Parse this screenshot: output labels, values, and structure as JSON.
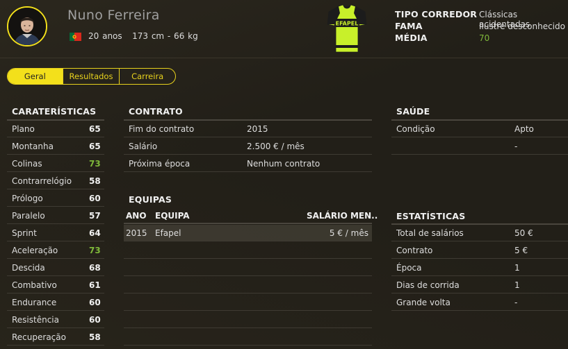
{
  "rider": {
    "name": "Nuno Ferreira",
    "age": "20 anos",
    "height_weight": "173 cm - 66 kg",
    "flag_colors": {
      "green": "#046a38",
      "red": "#da291c"
    }
  },
  "summary": [
    {
      "label": "TIPO CORREDOR",
      "value": "Clássicas acidentadas"
    },
    {
      "label": "FAMA",
      "value": "Ilustre desconhecido"
    },
    {
      "label": "MÉDIA",
      "value": "70"
    }
  ],
  "tabs": [
    "Geral",
    "Resultados",
    "Carreira"
  ],
  "characteristics": {
    "title": "CARATERÍSTICAS",
    "items": [
      {
        "label": "Plano",
        "value": "65"
      },
      {
        "label": "Montanha",
        "value": "65"
      },
      {
        "label": "Colinas",
        "value": "73"
      },
      {
        "label": "Contrarrelógio",
        "value": "58"
      },
      {
        "label": "Prólogo",
        "value": "60"
      },
      {
        "label": "Paralelo",
        "value": "57"
      },
      {
        "label": "Sprint",
        "value": "64"
      },
      {
        "label": "Aceleração",
        "value": "73"
      },
      {
        "label": "Descida",
        "value": "68"
      },
      {
        "label": "Combativo",
        "value": "61"
      },
      {
        "label": "Endurance",
        "value": "60"
      },
      {
        "label": "Resistência",
        "value": "60"
      },
      {
        "label": "Recuperação",
        "value": "58"
      }
    ]
  },
  "contract": {
    "title": "CONTRATO",
    "rows": [
      {
        "label": "Fim do contrato",
        "value": "2015"
      },
      {
        "label": "Salário",
        "value": "2.500 € / mês"
      },
      {
        "label": "Próxima época",
        "value": "Nenhum contrato"
      }
    ]
  },
  "teams": {
    "title": "EQUIPAS",
    "headers": {
      "year": "ANO",
      "team": "EQUIPA",
      "salary": "SALÁRIO MEN.."
    },
    "rows": [
      {
        "year": "2015",
        "team": "Efapel",
        "salary": "5 € / mês"
      }
    ]
  },
  "health": {
    "title": "SAÚDE",
    "rows": [
      {
        "label": "Condição",
        "value": "Apto"
      },
      {
        "label": "",
        "value": "-"
      }
    ]
  },
  "stats": {
    "title": "ESTATÍSTICAS",
    "rows": [
      {
        "label": "Total de salários",
        "value": "50 €"
      },
      {
        "label": "Contrato",
        "value": "5 €"
      },
      {
        "label": "Época",
        "value": "1"
      },
      {
        "label": "Dias de corrida",
        "value": "1"
      },
      {
        "label": "Grande volta",
        "value": "-"
      }
    ]
  },
  "jersey": {
    "text": "EFAPEL",
    "primary": "#c8f02a",
    "secondary": "#1c1c1c"
  }
}
